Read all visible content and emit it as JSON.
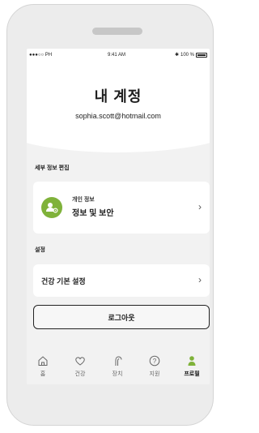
{
  "status_bar": {
    "signal": "●●●○○ PH",
    "time": "9:41 AM",
    "battery": "100 %"
  },
  "profile": {
    "title": "내 계정",
    "email": "sophia.scott@hotmail.com"
  },
  "sections": {
    "edit_details": "세부 정보 편집",
    "settings": "설정"
  },
  "personal_info": {
    "caption": "개인 정보",
    "label": "정보 및 보안"
  },
  "health_settings": {
    "label": "건강 기본 설정"
  },
  "logout_label": "로그아웃",
  "tabs": [
    {
      "label": "홈",
      "icon": "home-icon"
    },
    {
      "label": "건강",
      "icon": "heart-icon"
    },
    {
      "label": "장치",
      "icon": "hearing-device-icon"
    },
    {
      "label": "지원",
      "icon": "help-icon"
    },
    {
      "label": "프로필",
      "icon": "profile-icon",
      "active": true
    }
  ],
  "colors": {
    "accent": "#7fb23a",
    "text": "#1f1f1f",
    "background": "#f2f2f2"
  }
}
